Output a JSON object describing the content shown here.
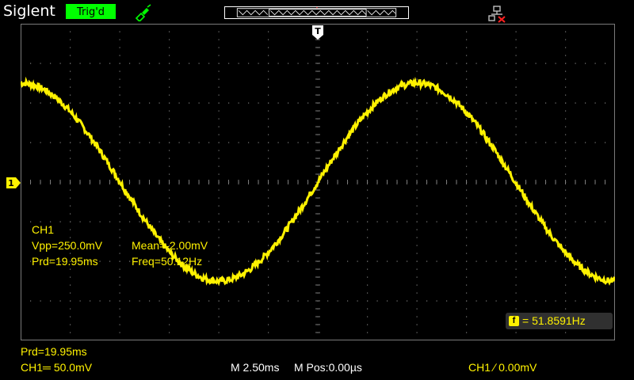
{
  "header": {
    "brand": "Siglent",
    "trigger_status": "Trig'd",
    "trigger_status_color": "#00ff00",
    "icons": [
      "probe-icon",
      "memory-depth-bar",
      "network-disconnected-icon"
    ]
  },
  "markers": {
    "trigger_position": "T",
    "channel_level": "1"
  },
  "measurements": {
    "channel": "CH1",
    "vpp_label": "Vpp=250.0mV",
    "mean_label": "Mean=-2.00mV",
    "prd_label": "Prd=19.95ms",
    "freq_label": "Freq=50.12Hz"
  },
  "counter": {
    "badge": "f",
    "value": "= 51.8591Hz"
  },
  "status_bar": {
    "period": "Prd=19.95ms",
    "ch1_scale": "CH1═ 50.0mV",
    "timebase": "M 2.50ms",
    "mpos": "M Pos:0.00µs",
    "trigger": "CH1 ∕ 0.00mV"
  },
  "colors": {
    "trace": "#fff200",
    "grid": "#7a7a7a",
    "background": "#000000"
  },
  "waveform": {
    "channel": "CH1",
    "frequency_hz": 50.12,
    "vpp_mv": 250.0,
    "mean_mv": -2.0,
    "volts_per_div_mv": 50.0,
    "time_per_div_ms": 2.5,
    "trigger_level_mv": 0.0,
    "trigger_slope": "rising"
  }
}
